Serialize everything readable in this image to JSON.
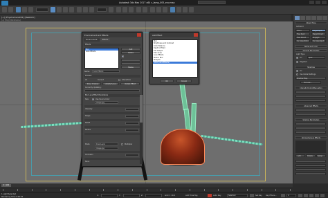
{
  "window": {
    "title": "Autodesk 3ds Max 2017 x64    c_lamp_005_env.max",
    "search_placeholder": "Type a keyword or phrase",
    "user_label": "Sign In",
    "workspaces_label": "Workspaces: Default"
  },
  "viewport": {
    "label": "[+] [PhysCamera001] [Realistic]",
    "sublabel": "[+] [Top] [Wireframe]"
  },
  "env_dialog": {
    "title": "Environment and Effects",
    "tabs": [
      "Environment",
      "Effects"
    ],
    "effects_header": "Effects",
    "effects_items": [
      "Blur",
      "Lens Effects"
    ],
    "name_label": "Name:",
    "name_value": "Lens Effects",
    "merge_label": "Merge",
    "preview_header": "Preview",
    "effects_radio_all": "All",
    "effects_radio_current": "Current",
    "interactive_label": "Interactive",
    "show_original": "Show Original",
    "update_scene": "Update Scene",
    "update_effect": "Update Effect",
    "currently_updating": "Currently Updating:",
    "params_header": "Blur Lens Effect Parameters",
    "size_label": "Size",
    "intensity_label": "Intensity",
    "occlusion_label": "Occlusion",
    "radius_label": "Radius",
    "use_source_color": "Use Source Color",
    "image_label": "Image",
    "image_value": "Image.jpg",
    "shape_label": "Shape",
    "falloff_label": "Falloff",
    "mode_label": "Mode",
    "mode_value": "Dual Layer",
    "multiplier_label": "Multiplier",
    "none_label": "None"
  },
  "add_dialog": {
    "title": "Add Effect",
    "items": [
      "Blur",
      "Brightness and Contrast",
      "Color Balance",
      "Depth of Field",
      "File Output",
      "Film Grain",
      "Lens Effects",
      "Motion Blur",
      "Sharpen",
      "Glow (Lens Effects)"
    ],
    "selected_index": 9,
    "ok_label": "OK",
    "cancel_label": "Cancel"
  },
  "command_panel": {
    "header": "Object Type",
    "autogrid": "AutoGrid",
    "rollouts": [
      "Name and Color",
      "Shadows",
      "Intensity/Color/Attenuation",
      "Advanced Effects",
      "Shadow Parameters",
      "Atmospheres & Effects",
      "Add",
      "Delete",
      "Setup"
    ],
    "type_items": [
      "Omni",
      "Target Spot",
      "Free Spot",
      "Target Direct",
      "Free Direct",
      "Skylight",
      "mr Area Omni",
      "mr Area Spot"
    ],
    "type_selected_index": 1,
    "general_header": "General Parameters",
    "lights_label": "Light Type",
    "on_label": "On",
    "spot_label": "Spot",
    "targeted_label": "Targeted",
    "shadows_on": "On",
    "use_global": "Use Global Settings",
    "shadow_map": "Shadow Map",
    "exclude": "Exclude..."
  },
  "timeline": {
    "frame": "0 / 100",
    "ticks_count": 20
  },
  "status": {
    "selection": "1 Light Selected",
    "prompt": "Rendering Time  0:00:01",
    "x_label": "X:",
    "y_label": "Y:",
    "z_label": "Z:",
    "grid_label": "Grid = 10.0",
    "auto_key": "Auto Key",
    "set_key": "Set Key",
    "selected": "Selected",
    "key_filters": "Key Filters...",
    "add_time_tag": "Add Time Tag",
    "frame_value": "0"
  },
  "colors": {
    "accent": "#3b7ad9",
    "viewport_bg": "#6e6e6e",
    "safe_frame": "#c9b45a",
    "live_frame": "#4a9aa8",
    "lamp": "#c7552a"
  }
}
